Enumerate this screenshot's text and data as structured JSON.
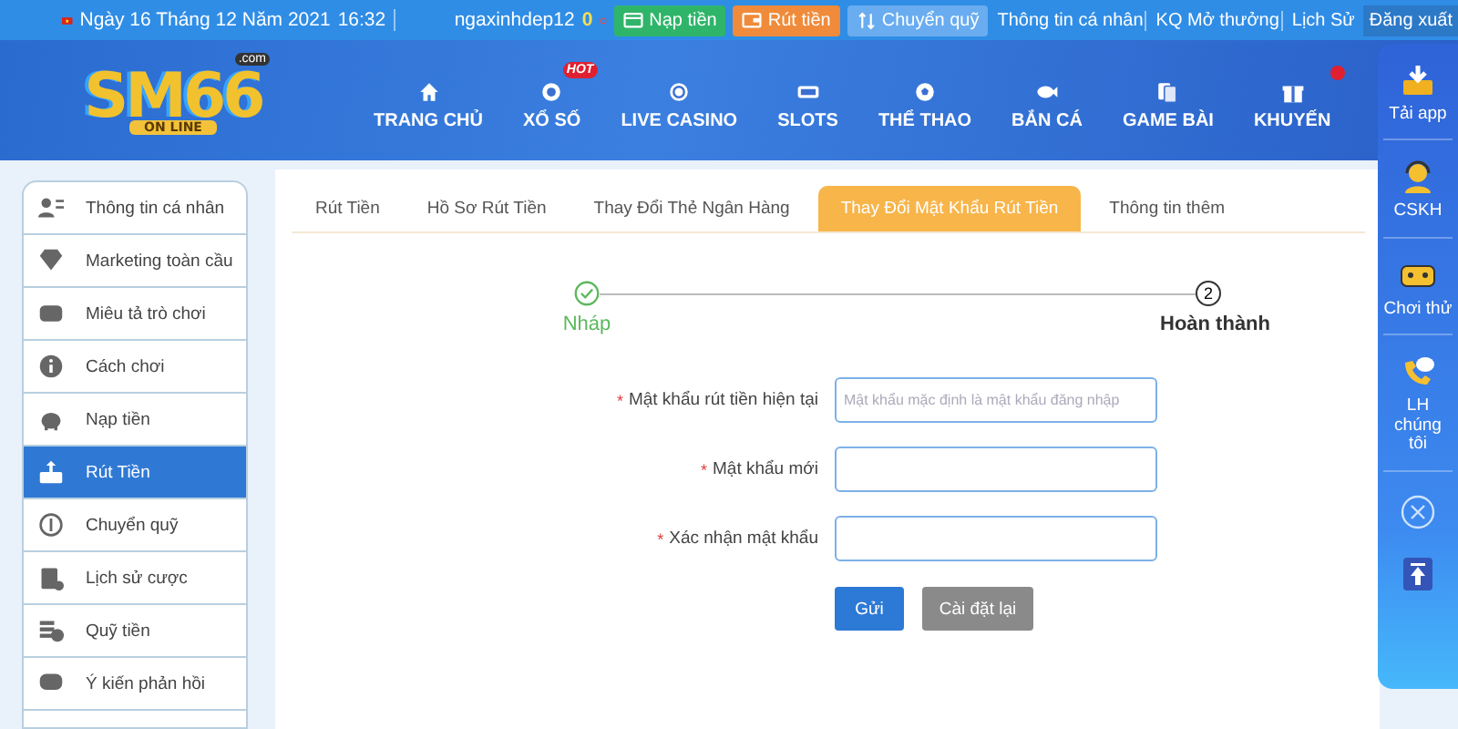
{
  "top_bar": {
    "date": "Ngày 16 Tháng 12 Năm 2021",
    "time": "16:32",
    "username": "ngaxinhdep12",
    "balance": "0",
    "actions": [
      {
        "label": "Nạp tiền",
        "kind": "deposit"
      },
      {
        "label": "Rút tiền",
        "kind": "withdraw"
      },
      {
        "label": "Chuyển quỹ",
        "kind": "transfer"
      }
    ],
    "links": [
      "Thông tin cá nhân",
      "KQ Mở thưởng",
      "Lịch Sử"
    ],
    "logout": "Đăng xuất"
  },
  "logo": {
    "name": "SM66",
    "domain": ".com",
    "tagline": "ON LINE"
  },
  "nav": [
    {
      "label": "TRANG CHỦ"
    },
    {
      "label": "XỔ SỐ",
      "badge": "HOT"
    },
    {
      "label": "LIVE CASINO"
    },
    {
      "label": "SLOTS"
    },
    {
      "label": "THỂ THAO"
    },
    {
      "label": "BẮN CÁ"
    },
    {
      "label": "GAME BÀI"
    },
    {
      "label": "KHUYẾN",
      "dot": true
    }
  ],
  "sidebar": {
    "items": [
      {
        "label": "Thông tin cá nhân",
        "selected": false
      },
      {
        "label": "Marketing toàn cầu",
        "selected": false
      },
      {
        "label": "Miêu tả trò chơi",
        "selected": false
      },
      {
        "label": "Cách chơi",
        "selected": false
      },
      {
        "label": "Nạp tiền",
        "selected": false
      },
      {
        "label": "Rút Tiền",
        "selected": true
      },
      {
        "label": "Chuyển quỹ",
        "selected": false
      },
      {
        "label": "Lịch sử cược",
        "selected": false
      },
      {
        "label": "Quỹ tiền",
        "selected": false
      },
      {
        "label": "Ý kiến phản hồi",
        "selected": false
      }
    ]
  },
  "tabs": [
    {
      "label": "Rút Tiền",
      "selected": false
    },
    {
      "label": "Hồ Sơ Rút Tiền",
      "selected": false
    },
    {
      "label": "Thay Đổi Thẻ Ngân Hàng",
      "selected": false
    },
    {
      "label": "Thay Đổi Mật Khẩu Rút Tiền",
      "selected": true
    },
    {
      "label": "Thông tin thêm",
      "selected": false
    }
  ],
  "steps": [
    {
      "label": "Nháp",
      "done": true
    },
    {
      "label": "Hoàn thành",
      "done": false,
      "number": "2"
    }
  ],
  "form": {
    "required_mark": "*",
    "fields": [
      {
        "label": "Mật khẩu rút tiền hiện tại",
        "required": true,
        "placeholder": "Mật khẩu mặc định là mật khẩu đăng nhập"
      },
      {
        "label": "Mật khẩu mới",
        "required": true
      },
      {
        "label": "Xác nhận mật khẩu",
        "required": true
      }
    ],
    "buttons": [
      {
        "label": "Gửi",
        "kind": "primary"
      },
      {
        "label": "Cài đặt lại",
        "kind": "secondary"
      }
    ]
  },
  "float_panel": {
    "items": [
      "Tải app",
      "CSKH",
      "Chơi thử",
      "LH chúng tôi"
    ]
  }
}
